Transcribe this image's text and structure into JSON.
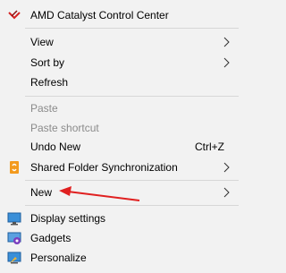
{
  "menu": {
    "items": [
      {
        "label": "AMD Catalyst Control Center",
        "icon": "amd-catalyst-icon"
      },
      {
        "label": "View",
        "submenu": true
      },
      {
        "label": "Sort by",
        "submenu": true
      },
      {
        "label": "Refresh"
      },
      {
        "label": "Paste",
        "disabled": true
      },
      {
        "label": "Paste shortcut",
        "disabled": true
      },
      {
        "label": "Undo New",
        "shortcut": "Ctrl+Z"
      },
      {
        "label": "Shared Folder Synchronization",
        "icon": "shared-folder-sync-icon",
        "submenu": true
      },
      {
        "label": "New",
        "submenu": true
      },
      {
        "label": "Display settings",
        "icon": "display-settings-icon"
      },
      {
        "label": "Gadgets",
        "icon": "gadgets-icon"
      },
      {
        "label": "Personalize",
        "icon": "personalize-icon"
      }
    ]
  },
  "annotation": {
    "arrow_color": "#e02020"
  }
}
